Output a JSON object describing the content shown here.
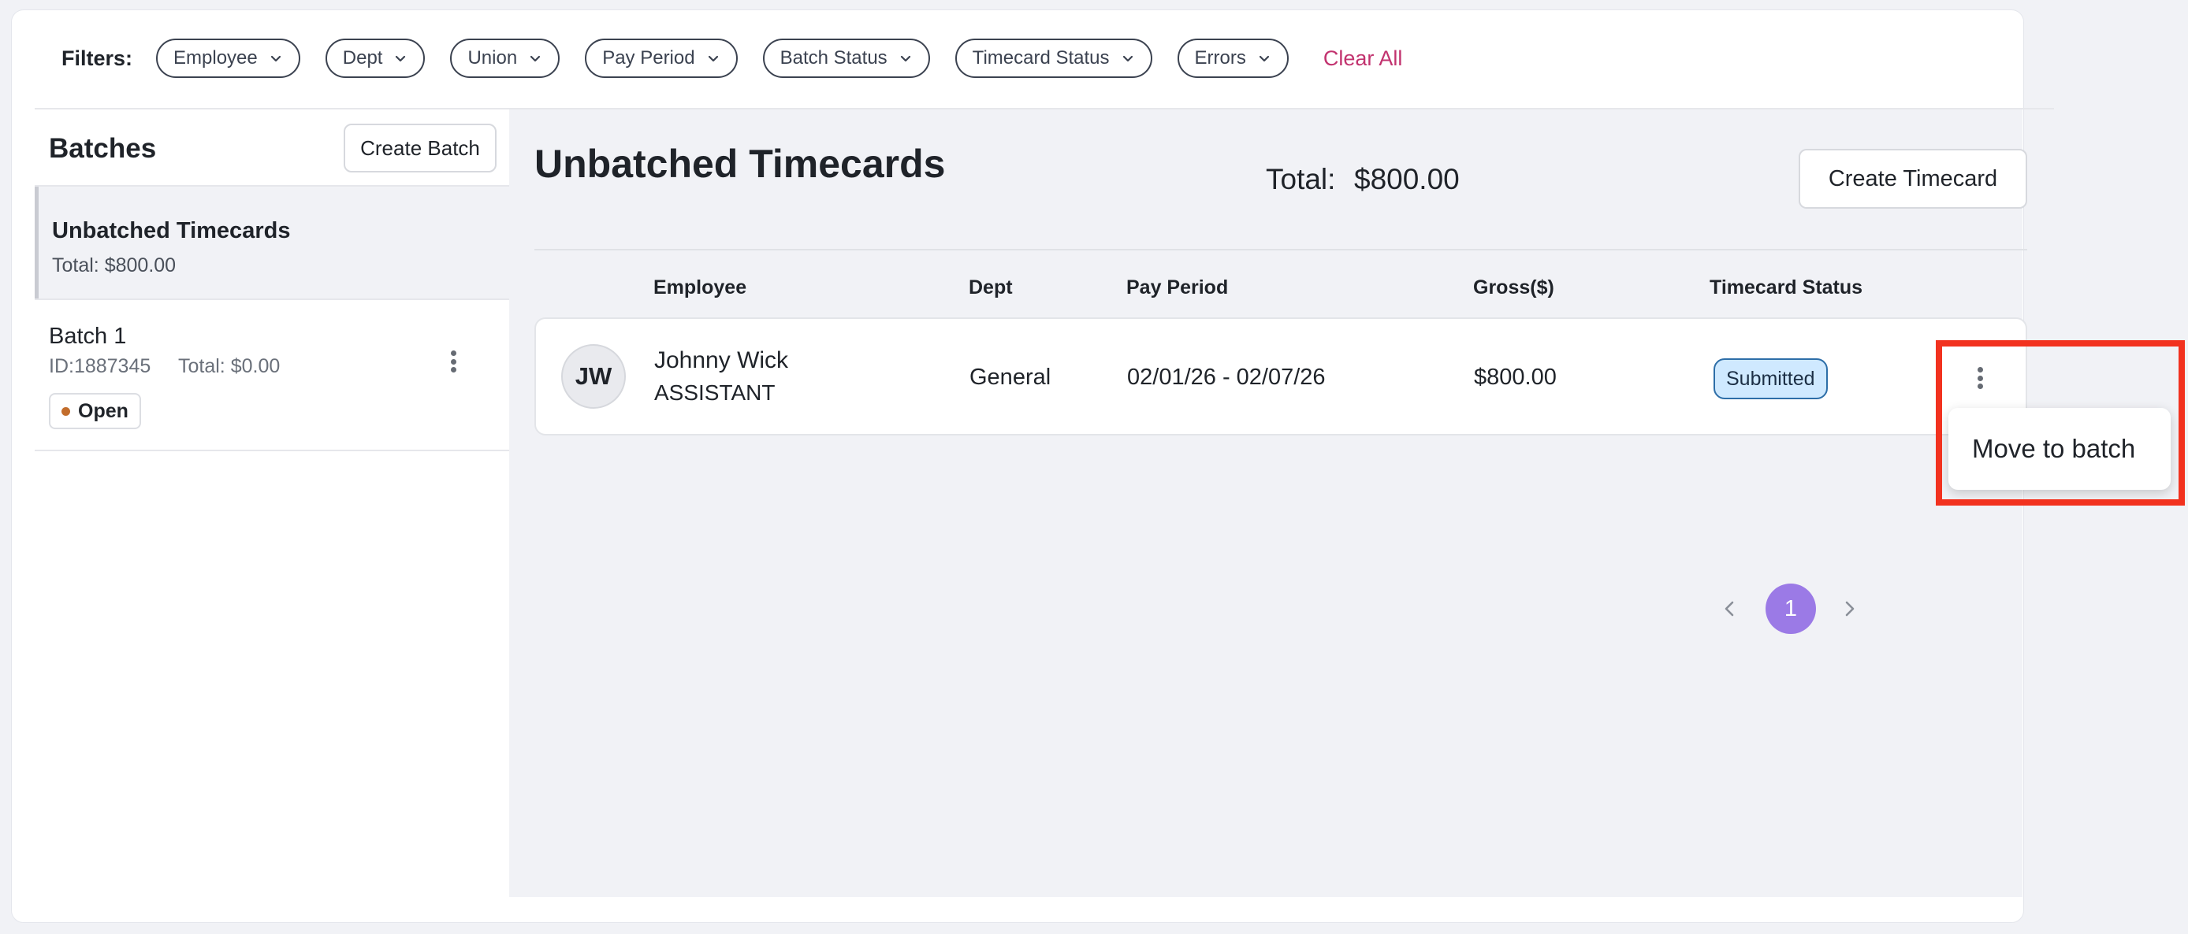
{
  "filters": {
    "label": "Filters:",
    "chips": [
      "Employee",
      "Dept",
      "Union",
      "Pay Period",
      "Batch Status",
      "Timecard Status",
      "Errors"
    ],
    "clear_all": "Clear All"
  },
  "sidebar": {
    "title": "Batches",
    "create_batch": "Create Batch",
    "unbatched": {
      "title": "Unbatched Timecards",
      "total": "Total:  $800.00"
    },
    "batch1": {
      "title": "Batch 1",
      "id": "ID:1887345",
      "total": "Total:  $0.00",
      "status": "Open"
    }
  },
  "main": {
    "title": "Unbatched Timecards",
    "total_label": "Total:",
    "total_value": "$800.00",
    "create_timecard": "Create Timecard",
    "columns": [
      "Employee",
      "Dept",
      "Pay Period",
      "Gross($)",
      "Timecard Status"
    ],
    "row": {
      "initials": "JW",
      "name": "Johnny Wick",
      "role": "ASSISTANT",
      "dept": "General",
      "pay_period": "02/01/26 - 02/07/26",
      "gross": "$800.00",
      "status": "Submitted"
    },
    "menu": {
      "move_to_batch": "Move to batch"
    },
    "pagination": {
      "current": "1"
    }
  },
  "colors": {
    "accent": "#9b7ae6",
    "clear_all": "#c2336f",
    "status_badge_bg": "#cfe9ff",
    "highlight": "#f2321f"
  },
  "icons": [
    "chevron-down-icon",
    "more-vertical-icon",
    "chevron-left-icon",
    "chevron-right-icon"
  ]
}
